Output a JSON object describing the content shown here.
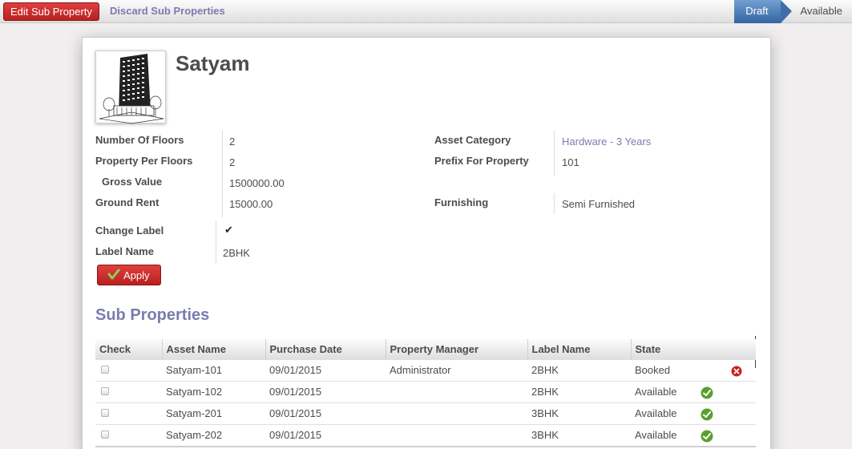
{
  "toolbar": {
    "edit_label": "Edit Sub Property",
    "discard_label": "Discard Sub Properties",
    "states": [
      "Draft",
      "Available"
    ]
  },
  "record": {
    "title": "Satyam",
    "image_icon": "building-icon"
  },
  "fields": {
    "number_of_floors": {
      "label": "Number Of Floors",
      "value": "2"
    },
    "property_per_floors": {
      "label": "Property Per Floors",
      "value": "2"
    },
    "gross_value": {
      "label": "Gross Value",
      "value": "1500000.00"
    },
    "ground_rent": {
      "label": "Ground Rent",
      "value": "15000.00"
    },
    "asset_category": {
      "label": "Asset Category",
      "value": "Hardware - 3 Years"
    },
    "prefix_for_property": {
      "label": "Prefix For Property",
      "value": "101"
    },
    "furnishing": {
      "label": "Furnishing",
      "value": "Semi Furnished"
    },
    "change_label": {
      "label": "Change Label",
      "checked": true
    },
    "label_name": {
      "label": "Label Name",
      "value": "2BHK"
    }
  },
  "apply_label": "Apply",
  "sub_properties": {
    "title": "Sub Properties",
    "columns": [
      "Check",
      "Asset Name",
      "Purchase Date",
      "Property Manager",
      "Label Name",
      "State"
    ],
    "rows": [
      {
        "asset_name": "Satyam-101",
        "purchase_date": "09/01/2015",
        "manager": "Administrator",
        "label": "2BHK",
        "state": "Booked",
        "icon": "cross-icon"
      },
      {
        "asset_name": "Satyam-102",
        "purchase_date": "09/01/2015",
        "manager": "",
        "label": "2BHK",
        "state": "Available",
        "icon": "check-icon"
      },
      {
        "asset_name": "Satyam-201",
        "purchase_date": "09/01/2015",
        "manager": "",
        "label": "3BHK",
        "state": "Available",
        "icon": "check-icon"
      },
      {
        "asset_name": "Satyam-202",
        "purchase_date": "09/01/2015",
        "manager": "",
        "label": "3BHK",
        "state": "Available",
        "icon": "check-icon"
      }
    ]
  },
  "colors": {
    "brand_red": "#c62828",
    "link_purple": "#7c7bad",
    "draft_blue": "#3465a4",
    "ok_green": "#5aa02c",
    "error_red": "#cc1f1f"
  }
}
